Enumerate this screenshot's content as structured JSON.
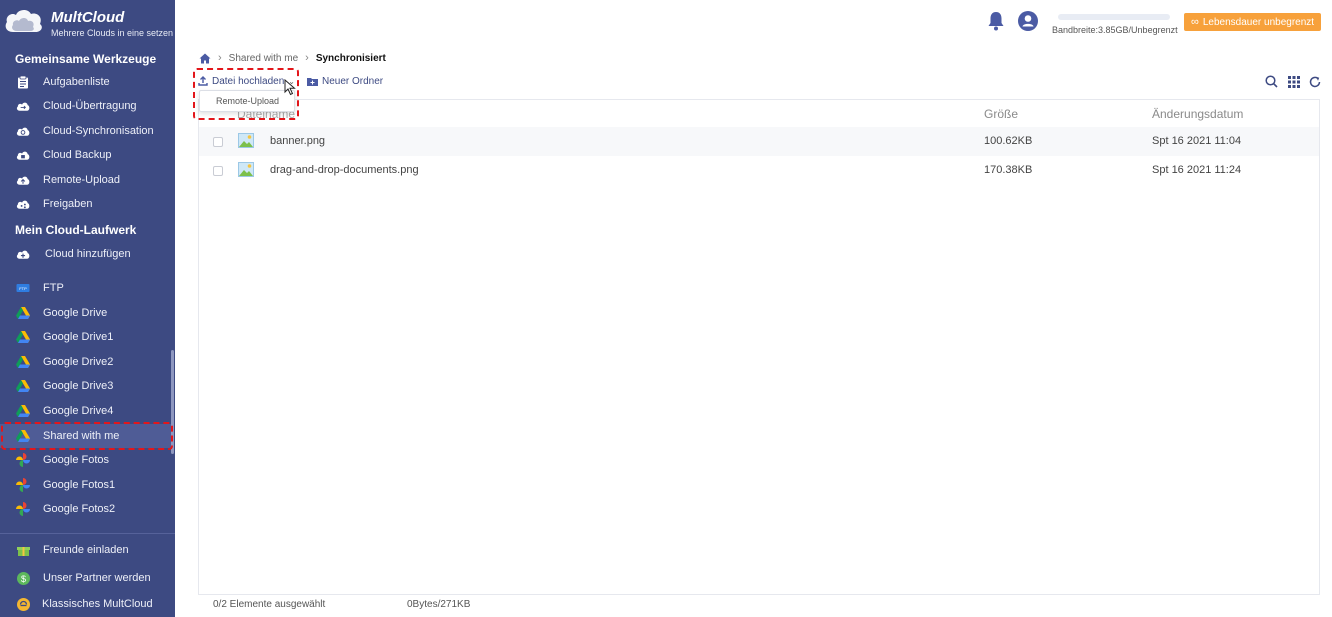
{
  "brand": {
    "name": "MultCloud",
    "tagline": "Mehrere Clouds in eine setzen"
  },
  "sidebar": {
    "tools_title": "Gemeinsame Werkzeuge",
    "tools": [
      {
        "label": "Aufgabenliste",
        "icon": "clipboard-icon"
      },
      {
        "label": "Cloud-Übertragung",
        "icon": "cloud-transfer-icon"
      },
      {
        "label": "Cloud-Synchronisation",
        "icon": "cloud-sync-icon"
      },
      {
        "label": "Cloud Backup",
        "icon": "cloud-backup-icon"
      },
      {
        "label": "Remote-Upload",
        "icon": "cloud-upload-icon"
      },
      {
        "label": "Freigaben",
        "icon": "share-icon"
      }
    ],
    "drive_title": "Mein Cloud-Laufwerk",
    "add_cloud": "Cloud hinzufügen",
    "clouds": [
      {
        "label": "FTP",
        "icon": "ftp-icon"
      },
      {
        "label": "Google Drive",
        "icon": "google-drive-icon"
      },
      {
        "label": "Google Drive1",
        "icon": "google-drive-icon"
      },
      {
        "label": "Google Drive2",
        "icon": "google-drive-icon"
      },
      {
        "label": "Google Drive3",
        "icon": "google-drive-icon"
      },
      {
        "label": "Google Drive4",
        "icon": "google-drive-icon"
      },
      {
        "label": "Shared with me",
        "icon": "google-drive-icon"
      },
      {
        "label": "Google Fotos",
        "icon": "google-photos-icon"
      },
      {
        "label": "Google Fotos1",
        "icon": "google-photos-icon"
      },
      {
        "label": "Google Fotos2",
        "icon": "google-photos-icon"
      }
    ],
    "bottom": [
      {
        "label": "Freunde einladen",
        "icon": "gift-icon"
      },
      {
        "label": "Unser Partner werden",
        "icon": "dollar-icon"
      },
      {
        "label": "Klassisches MultCloud",
        "icon": "classic-icon"
      }
    ]
  },
  "header": {
    "bandwidth": "Bandbreite:3.85GB/Unbegrenzt",
    "lifetime_button": "Lebensdauer unbegrenzt"
  },
  "breadcrumb": {
    "folder": "Shared with me",
    "current": "Synchronisiert"
  },
  "toolbar": {
    "upload": "Datei hochladen",
    "new_folder": "Neuer Ordner"
  },
  "dropdown": {
    "remote_upload": "Remote-Upload"
  },
  "table": {
    "columns": {
      "name": "Dateiname",
      "size": "Größe",
      "date": "Änderungsdatum"
    },
    "rows": [
      {
        "name": "banner.png",
        "size": "100.62KB",
        "date": "Spt 16 2021 11:04"
      },
      {
        "name": "drag-and-drop-documents.png",
        "size": "170.38KB",
        "date": "Spt 16 2021 11:24"
      }
    ]
  },
  "footer": {
    "selected": "0/2 Elemente ausgewählt",
    "size": "0Bytes/271KB"
  },
  "colors": {
    "sidebar": "#3d4a82",
    "accent": "#f7a13b",
    "highlight": "#e3161b"
  }
}
